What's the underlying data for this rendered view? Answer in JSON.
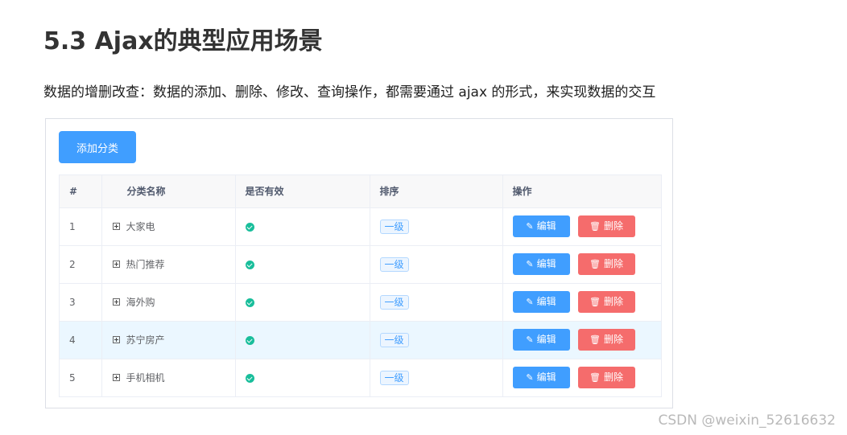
{
  "article": {
    "heading": "5.3 Ajax的典型应用场景",
    "paragraph": "数据的增删改查：数据的添加、删除、修改、查询操作，都需要通过 ajax 的形式，来实现数据的交互"
  },
  "demo": {
    "add_button": "添加分类",
    "columns": [
      "#",
      "分类名称",
      "是否有效",
      "排序",
      "操作"
    ],
    "rows": [
      {
        "index": "1",
        "name": "大家电",
        "level": "一级"
      },
      {
        "index": "2",
        "name": "热门推荐",
        "level": "一级"
      },
      {
        "index": "3",
        "name": "海外购",
        "level": "一级"
      },
      {
        "index": "4",
        "name": "苏宁房产",
        "level": "一级"
      },
      {
        "index": "5",
        "name": "手机相机",
        "level": "一级"
      }
    ],
    "edit_label": "编辑",
    "delete_label": "删除",
    "icons": {
      "expand": "plus-square-icon",
      "valid": "check-circle-icon",
      "edit": "pencil-icon",
      "delete": "trash-icon"
    },
    "colors": {
      "primary": "#409eff",
      "danger": "#f56c6c",
      "success": "#19be9b",
      "hover_row": "#ebf7ff"
    }
  },
  "watermark": "CSDN @weixin_52616632"
}
